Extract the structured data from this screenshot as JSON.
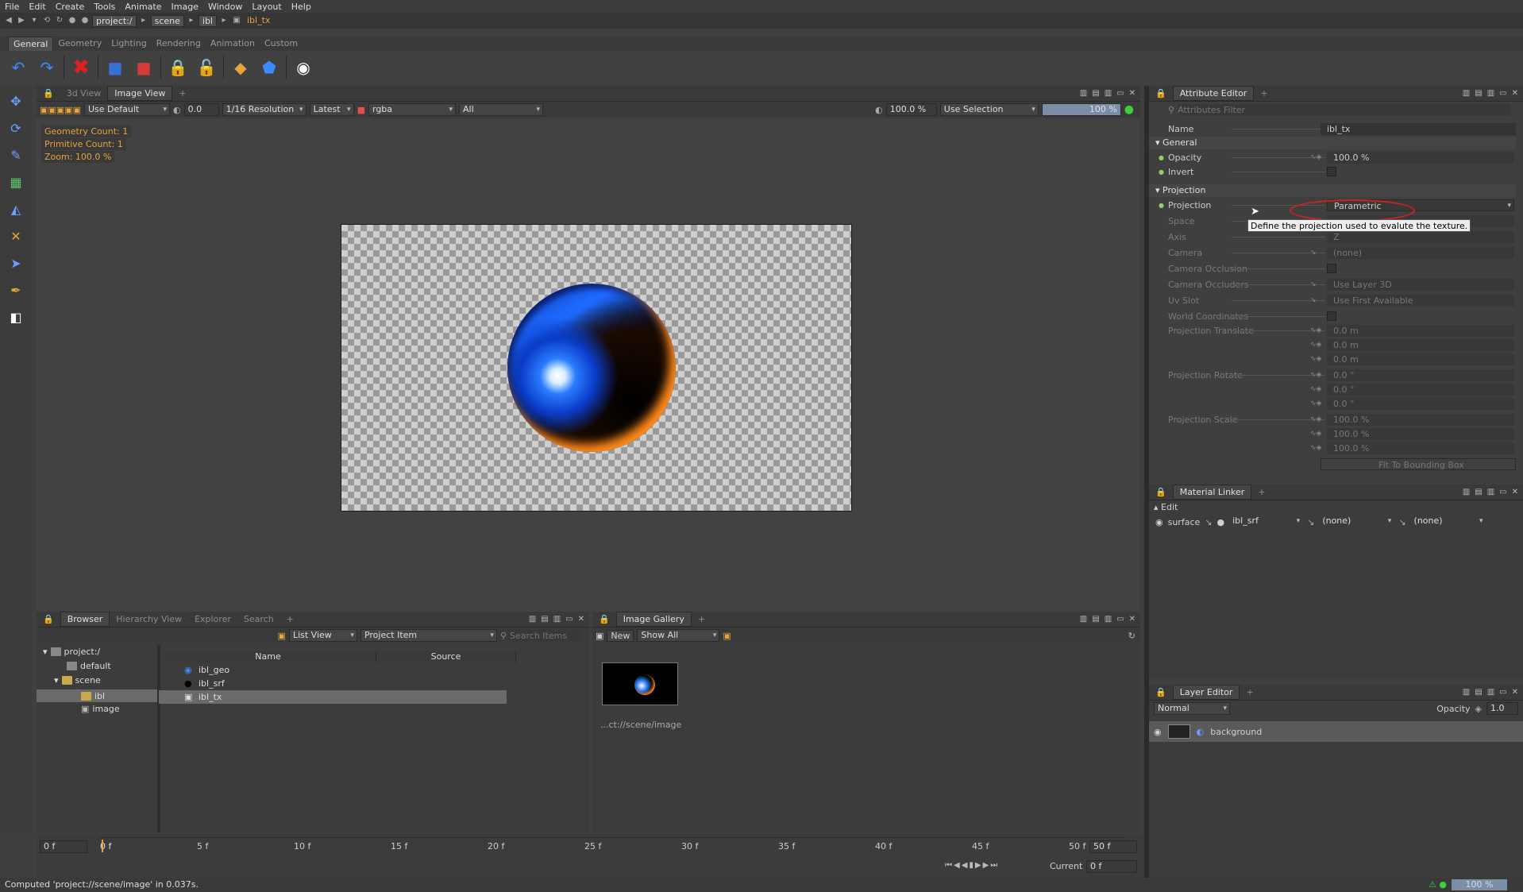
{
  "menu": [
    "File",
    "Edit",
    "Create",
    "Tools",
    "Animate",
    "Image",
    "Window",
    "Layout",
    "Help"
  ],
  "path": {
    "crumbs": [
      "project:/",
      "scene",
      "ibl"
    ],
    "current": "ibl_tx"
  },
  "shelf_tabs": [
    "General",
    "Geometry",
    "Lighting",
    "Rendering",
    "Animation",
    "Custom"
  ],
  "viewer": {
    "tabs": [
      "3d View",
      "Image View"
    ],
    "use_default": "Use Default",
    "exposure": "0.0",
    "resolution": "1/16 Resolution",
    "latest": "Latest",
    "channels": "rgba",
    "layers": "All",
    "zoom": "100.0 %",
    "selection_mode": "Use Selection",
    "progress_pct": "100 %",
    "overlay": [
      "Geometry Count: 1",
      "Primitive Count: 1",
      "Zoom: 100.0 %"
    ]
  },
  "attr": {
    "title": "Attribute Editor",
    "filter_placeholder": "Attributes Filter",
    "name_label": "Name",
    "name_value": "ibl_tx",
    "general": "General",
    "opacity_label": "Opacity",
    "opacity_value": "100.0 %",
    "invert_label": "Invert",
    "projection_section": "Projection",
    "projection_label": "Projection",
    "projection_value": "Parametric",
    "space": "Space",
    "axis": "Axis",
    "axis_value": "Z",
    "camera": "Camera",
    "camera_value": "(none)",
    "camera_occlusion": "Camera Occlusion",
    "camera_occluders": "Camera Occluders",
    "camera_occluders_value": "Use Layer 3D",
    "uv_slot": "Uv Slot",
    "uv_slot_value": "Use First Available",
    "world_coords": "World Coordinates",
    "proj_translate": "Projection Translate",
    "translate_vals": [
      "0.0 m",
      "0.0 m",
      "0.0 m"
    ],
    "proj_rotate": "Projection Rotate",
    "rotate_vals": [
      "0.0 °",
      "0.0 °",
      "0.0 °"
    ],
    "proj_scale": "Projection Scale",
    "scale_vals": [
      "100.0 %",
      "100.0 %",
      "100.0 %"
    ],
    "fit_bbox": "Fit To Bounding Box",
    "tooltip": "Define the projection used to evalute the texture."
  },
  "material": {
    "title": "Material Linker",
    "edit": "Edit",
    "surface": "surface",
    "srf": "ibl_srf",
    "none1": "(none)",
    "none2": "(none)"
  },
  "layers": {
    "title": "Layer Editor",
    "mode": "Normal",
    "opacity_label": "Opacity",
    "opacity_value": "1.0",
    "layer": "background"
  },
  "browser": {
    "tabs": [
      "Browser",
      "Hierarchy View",
      "Explorer",
      "Search"
    ],
    "view": "List View",
    "filter": "Project Item",
    "search_placeholder": "Search Items",
    "tree": [
      "project:/",
      "default",
      "scene",
      "ibl",
      "image"
    ],
    "col_name": "Name",
    "col_source": "Source",
    "rows": [
      "ibl_geo",
      "ibl_srf",
      "ibl_tx"
    ]
  },
  "gallery": {
    "title": "Image Gallery",
    "new": "New",
    "show": "Show All",
    "caption": "...ct://scene/image"
  },
  "timeline": {
    "start": "0 f",
    "end": "50 f",
    "ticks": [
      "0 f",
      "5 f",
      "10 f",
      "15 f",
      "20 f",
      "25 f",
      "30 f",
      "35 f",
      "40 f",
      "45 f",
      "50 f"
    ],
    "current_label": "Current",
    "current_value": "0 f"
  },
  "status": {
    "message": "Computed 'project://scene/image' in 0.037s.",
    "zoom": "100 %"
  }
}
